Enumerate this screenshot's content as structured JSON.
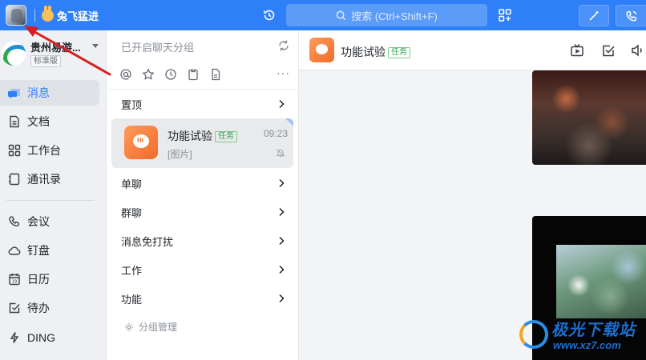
{
  "topbar": {
    "org_short": "兔飞猛进",
    "search_placeholder": "搜索 (Ctrl+Shift+F)"
  },
  "org": {
    "name": "贵州易游...",
    "edition": "标准版"
  },
  "nav": {
    "items": [
      {
        "label": "消息",
        "icon": "chat-icon"
      },
      {
        "label": "文档",
        "icon": "doc-icon"
      },
      {
        "label": "工作台",
        "icon": "grid-icon"
      },
      {
        "label": "通讯录",
        "icon": "contacts-icon"
      },
      {
        "label": "会议",
        "icon": "phone-icon"
      },
      {
        "label": "钉盘",
        "icon": "cloud-icon"
      },
      {
        "label": "日历",
        "icon": "calendar-icon"
      },
      {
        "label": "待办",
        "icon": "check-icon"
      },
      {
        "label": "DING",
        "icon": "bolt-icon"
      }
    ]
  },
  "midcol": {
    "group_hint": "已开启聊天分组",
    "sections": {
      "pinned": "置顶",
      "single": "单聊",
      "group": "群聊",
      "dnd": "消息免打扰",
      "work": "工作",
      "function": "功能"
    },
    "conversation": {
      "name": "功能试验",
      "tag": "任务",
      "time": "09:23",
      "preview": "[图片]"
    },
    "group_manage": "分组管理"
  },
  "chat": {
    "title": "功能试验",
    "tag": "任务"
  },
  "watermark": {
    "text": "极光下载站",
    "url": "www.xz7.com"
  },
  "colors": {
    "brand": "#2f80f8",
    "annotation": "#d81e1e",
    "task_tag": "#2ea04d"
  }
}
